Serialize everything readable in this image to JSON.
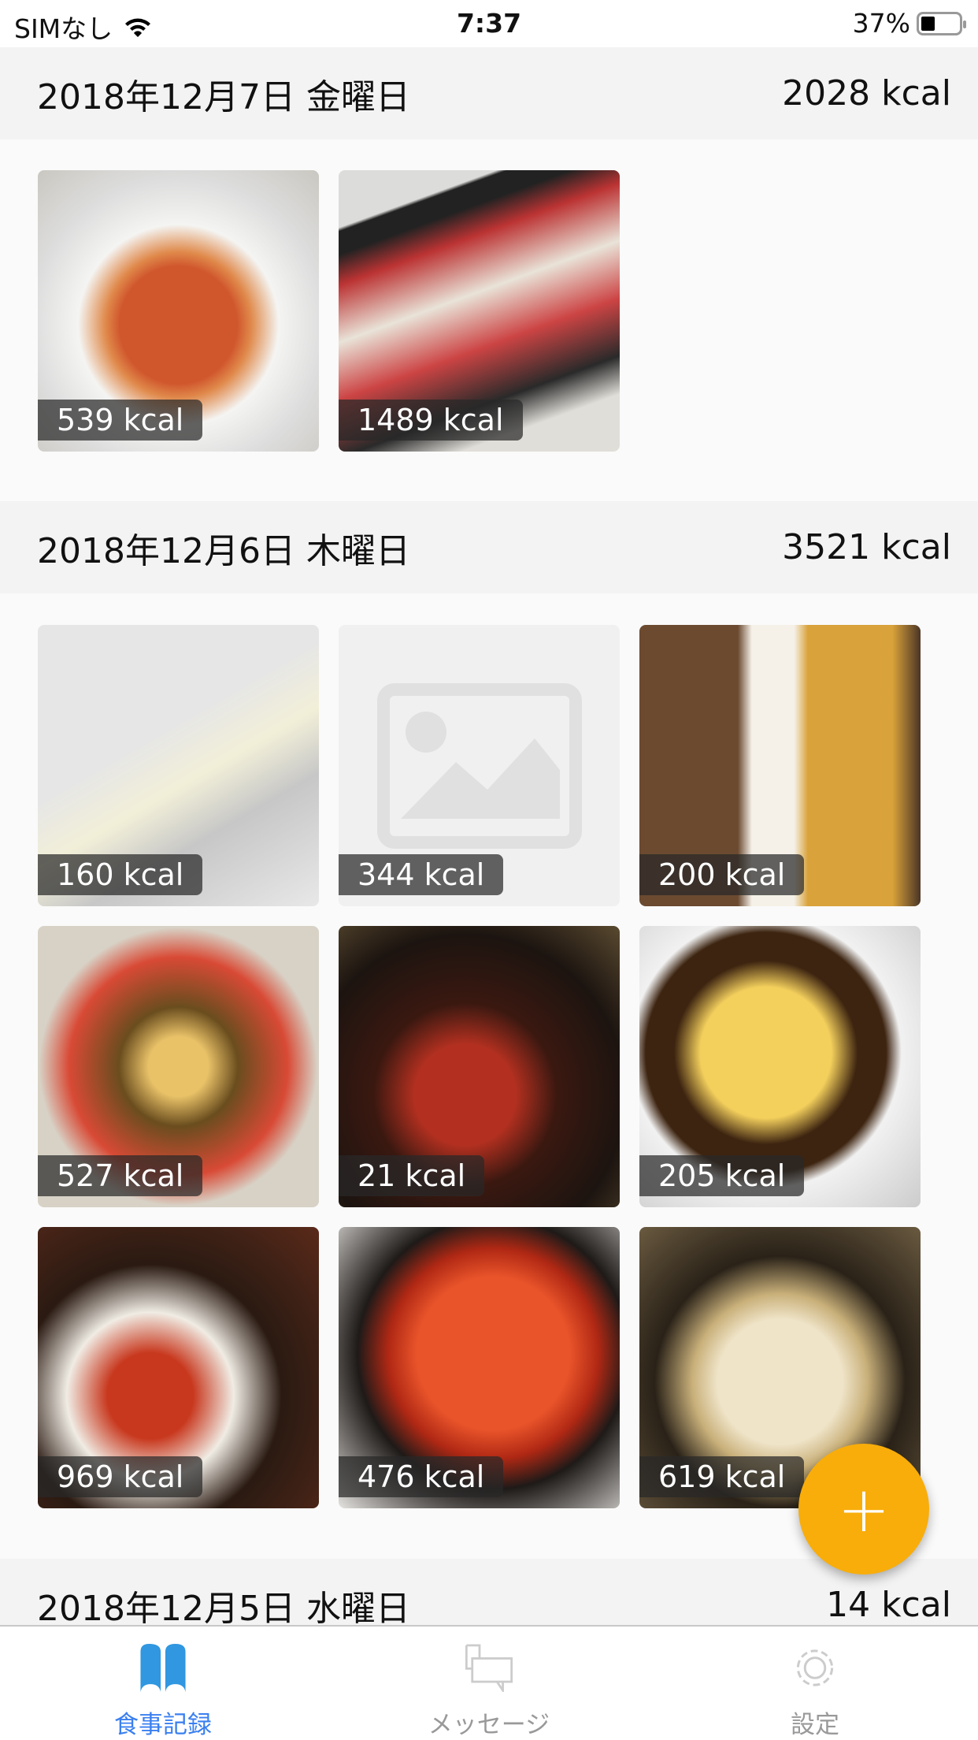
{
  "status": {
    "carrier": "SIMなし",
    "time": "7:37",
    "battery": "37%"
  },
  "days": [
    {
      "date": "2018年12月7日 金曜日",
      "total": "2028 kcal",
      "meals": [
        {
          "kcal": "539 kcal",
          "photo": "pasta"
        },
        {
          "kcal": "1489 kcal",
          "photo": "sushi"
        }
      ]
    },
    {
      "date": "2018年12月6日 木曜日",
      "total": "3521 kcal",
      "meals": [
        {
          "kcal": "160 kcal",
          "photo": "cheese"
        },
        {
          "kcal": "344 kcal",
          "photo": "none"
        },
        {
          "kcal": "200 kcal",
          "photo": "beer"
        },
        {
          "kcal": "527 kcal",
          "photo": "bento"
        },
        {
          "kcal": "21 kcal",
          "photo": "fish"
        },
        {
          "kcal": "205 kcal",
          "photo": "omurice"
        },
        {
          "kcal": "969 kcal",
          "photo": "donburi"
        },
        {
          "kcal": "476 kcal",
          "photo": "mapo"
        },
        {
          "kcal": "619 kcal",
          "photo": "ramen"
        }
      ]
    },
    {
      "date": "2018年12月5日 水曜日",
      "total": "14 kcal"
    }
  ],
  "fab": "+",
  "tabs": [
    {
      "label": "食事記録"
    },
    {
      "label": "メッセージ"
    },
    {
      "label": "設定"
    }
  ],
  "colors": {
    "accent": "#f8ad0a",
    "tab_active": "#3a7ff0",
    "icon_active": "#3097e0"
  }
}
